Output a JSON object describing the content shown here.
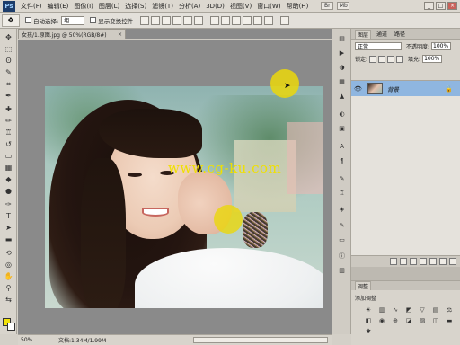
{
  "app": {
    "logo": "Ps",
    "menu": [
      "文件(F)",
      "编辑(E)",
      "图像(I)",
      "图层(L)",
      "选择(S)",
      "滤镜(T)",
      "分析(A)",
      "3D(D)",
      "视图(V)",
      "窗口(W)",
      "帮助(H)"
    ],
    "window_buttons": [
      "_",
      "□",
      "×"
    ]
  },
  "options_bar": {
    "auto_select_label": "自动选择:",
    "auto_select_value": "组",
    "show_transform_label": "显示变换控件"
  },
  "document": {
    "tab_title": "女孩/1.原图.jpg @ 50%(RGB/8#)",
    "tab_close": "×",
    "watermark": "www.cg-ku.com",
    "zoom": "50%",
    "doc_info": "文档:1.34M/1.99M"
  },
  "layers_panel": {
    "tabs": [
      "图层",
      "通道",
      "路径"
    ],
    "blend_mode": "正常",
    "opacity_label": "不透明度:",
    "opacity_value": "100%",
    "lock_label": "锁定:",
    "fill_label": "填充:",
    "fill_value": "100%",
    "layers": [
      {
        "name": "背景",
        "visible": true,
        "locked": true,
        "selected": true
      }
    ]
  },
  "adjustments_panel": {
    "title": "调整",
    "subtitle": "添加调整"
  },
  "colors": {
    "foreground": "#f2e20a",
    "background": "#ffffff",
    "selection": "#8fb6e0",
    "cursor_highlight": "#ebd70a"
  }
}
